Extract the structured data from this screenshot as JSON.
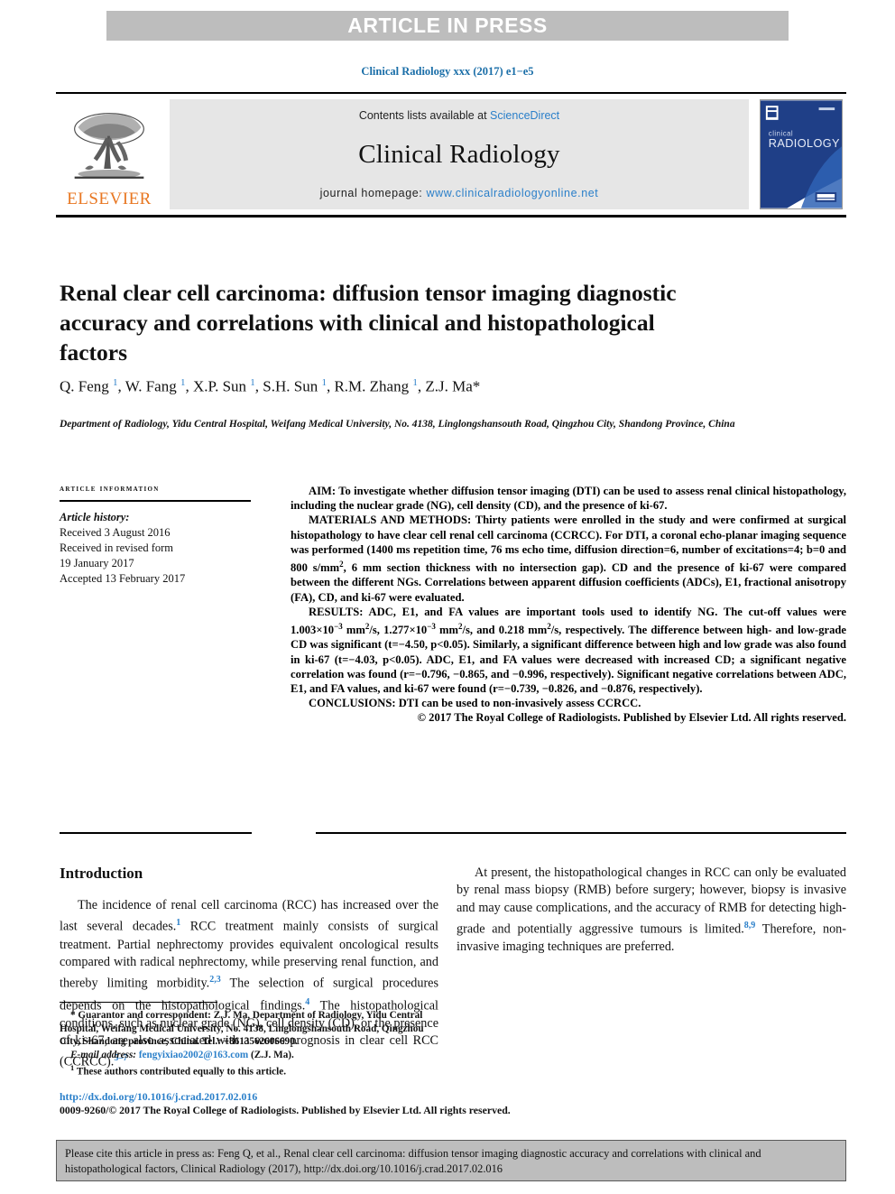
{
  "banner": {
    "text": "ARTICLE IN PRESS"
  },
  "running_head": "Clinical Radiology xxx (2017) e1−e5",
  "masthead": {
    "publisher": "ELSEVIER",
    "contents_prefix": "Contents lists available at ",
    "contents_link": "ScienceDirect",
    "journal_name": "Clinical Radiology",
    "homepage_prefix": "journal homepage: ",
    "homepage_url": "www.clinicalradiologyonline.net",
    "cover_title_small": "clinical",
    "cover_title_large": "RADIOLOGY"
  },
  "article": {
    "title": "Renal clear cell carcinoma: diffusion tensor imaging diagnostic accuracy and correlations with clinical and histopathological factors",
    "authors_html": "Q. Feng <sup>1</sup>, W. Fang <sup>1</sup>, X.P. Sun <sup>1</sup>, S.H. Sun <sup>1</sup>, R.M. Zhang <sup>1</sup>, Z.J. Ma<span class=\"star\">*</span>",
    "affiliation": "Department of Radiology, Yidu Central Hospital, Weifang Medical University, No. 4138, Linglongshansouth Road, Qingzhou City, Shandong Province, China"
  },
  "article_information": {
    "heading": "article information",
    "history_label": "Article history:",
    "history": [
      "Received 3 August 2016",
      "Received in revised form",
      "19 January 2017",
      "Accepted 13 February 2017"
    ]
  },
  "abstract": {
    "aim": "AIM: To investigate whether diffusion tensor imaging (DTI) can be used to assess renal clinical histopathology, including the nuclear grade (NG), cell density (CD), and the presence of ki-67.",
    "materials_and_methods_html": "MATERIALS AND METHODS: Thirty patients were enrolled in the study and were confirmed at surgical histopathology to have clear cell renal cell carcinoma (CCRCC). For DTI, a coronal echo-planar imaging sequence was performed (1400 ms repetition time, 76 ms echo time, diffusion direction=6, number of excitations=4; b=0 and 800 s/mm<sup>2</sup>, 6 mm section thickness with no intersection gap). CD and the presence of ki-67 were compared between the different NGs. Correlations between apparent diffusion coefficients (ADCs), E1, fractional anisotropy (FA), CD, and ki-67 were evaluated.",
    "results_html": "RESULTS: ADC, E1, and FA values are important tools used to identify NG. The cut-off values were 1.003×10<sup>−3</sup> mm<sup>2</sup>/s, 1.277×10<sup>−3</sup> mm<sup>2</sup>/s, and 0.218 mm<sup>2</sup>/s, respectively. The difference between high- and low-grade CD was significant (t=−4.50, p&lt;0.05). Similarly, a significant difference between high and low grade was also found in ki-67 (t=−4.03, p&lt;0.05). ADC, E1, and FA values were decreased with increased CD; a significant negative correlation was found (r=−0.796, −0.865, and −0.996, respectively). Significant negative correlations between ADC, E1, and FA values, and ki-67 were found (r=−0.739, −0.826, and −0.876, respectively).",
    "conclusions": "CONCLUSIONS: DTI can be used to non-invasively assess CCRCC.",
    "copyright": "© 2017 The Royal College of Radiologists. Published by Elsevier Ltd. All rights reserved."
  },
  "introduction": {
    "heading": "Introduction",
    "paragraph_1_html": "The incidence of renal cell carcinoma (RCC) has increased over the last several decades.<sup>1</sup> RCC treatment mainly consists of surgical treatment. Partial nephrectomy provides equivalent oncological results compared with radical nephrectomy, while preserving renal function, and thereby limiting morbidity.<sup>2,3</sup> The selection of surgical procedures depends on the histopathological findings.<sup>4</sup> The histopathological conditions, such as nuclear grade (NG), cell density (CD), or the presence of ki–67, are also associated with a worse prognosis in clear cell RCC (CCRCC).<sup>5–7</sup>",
    "paragraph_2_html": "At present, the histopathological changes in RCC can only be evaluated by renal mass biopsy (RMB) before surgery; however, biopsy is invasive and may cause complications, and the accuracy of RMB for detecting high-grade and potentially aggressive tumours is limited.<sup>8,9</sup> Therefore, non-invasive imaging techniques are preferred."
  },
  "footnotes": {
    "guarantor_html": "* Guarantor and correspondent: Z.J. Ma, Department of Radiology, Yidu Central Hospital, Weifang Medical University, No. 4138, Linglongshansouth Road, Qingzhou City, Shandong province, China. Tel.: +8613562606690.",
    "email_label": "E-mail address:",
    "email_address": "fengyixiao2002@163.com",
    "email_suffix": "(Z.J. Ma).",
    "equal_contribution_marker": "1",
    "equal_contribution": "These authors contributed equally to this article."
  },
  "doi_block": {
    "doi": "http://dx.doi.org/10.1016/j.crad.2017.02.016",
    "issn_line": "0009-9260/© 2017 The Royal College of Radiologists. Published by Elsevier Ltd. All rights reserved."
  },
  "citation_box": {
    "text": "Please cite this article in press as: Feng Q, et al., Renal clear cell carcinoma: diffusion tensor imaging diagnostic accuracy and correlations with clinical and histopathological factors, Clinical Radiology (2017), http://dx.doi.org/10.1016/j.crad.2017.02.016"
  },
  "colors": {
    "banner_gray": "#bdbdbd",
    "link_blue": "#2a7fc9",
    "running_head_blue": "#1a6ea8",
    "elsevier_orange": "#e87722",
    "masthead_gray": "#e6e6e6",
    "cover_blue": "#1f3f87"
  }
}
